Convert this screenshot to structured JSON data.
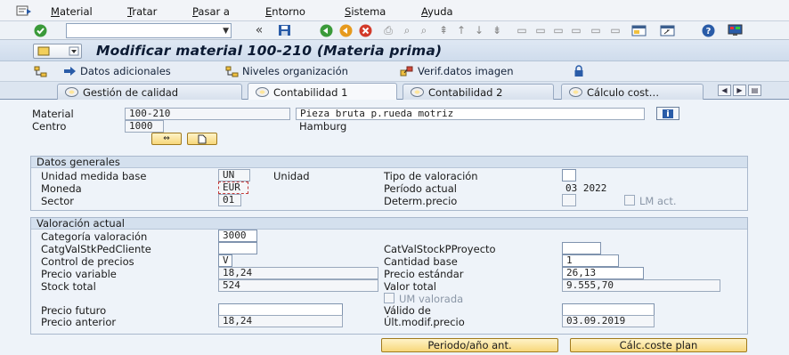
{
  "menu": {
    "items": [
      "Material",
      "Tratar",
      "Pasar a",
      "Entorno",
      "Sistema",
      "Ayuda"
    ],
    "underlined": [
      "M",
      "T",
      "P",
      "E",
      "S",
      "A"
    ]
  },
  "toolbar": {
    "command_value": "",
    "back_glyph": "«"
  },
  "title": {
    "text": "Modificar material 100-210 (Materia prima)"
  },
  "app_toolbar": {
    "items": [
      "Datos adicionales",
      "Niveles organización",
      "Verif.datos imagen"
    ]
  },
  "tabs": {
    "items": [
      "Gestión de calidad",
      "Contabilidad 1",
      "Contabilidad 2",
      "Cálculo cost…"
    ],
    "active": "Contabilidad 1"
  },
  "header": {
    "material_label": "Material",
    "material_value": "100-210",
    "material_desc": "Pieza bruta p.rueda motriz",
    "centro_label": "Centro",
    "centro_value": "1000",
    "centro_desc": "Hamburg"
  },
  "datos_generales": {
    "title": "Datos generales",
    "unidad_label": "Unidad medida base",
    "unidad_value": "UN",
    "unidad_desc": "Unidad",
    "moneda_label": "Moneda",
    "moneda_value": "EUR",
    "sector_label": "Sector",
    "sector_value": "01",
    "tipo_val_label": "Tipo de valoración",
    "periodo_label": "Período actual",
    "periodo_value": "03 2022",
    "determ_label": "Determ.precio",
    "lm_label": "LM act."
  },
  "valoracion": {
    "title": "Valoración actual",
    "categoria_label": "Categoría valoración",
    "categoria_value": "3000",
    "catgval_label": "CatgValStkPedCliente",
    "catval_proy_label": "CatValStockPProyecto",
    "control_label": "Control de precios",
    "control_value": "V",
    "cantidad_base_label": "Cantidad base",
    "cantidad_base_value": "1",
    "precio_variable_label": "Precio variable",
    "precio_variable_value": "18,24",
    "precio_estandar_label": "Precio estándar",
    "precio_estandar_value": "26,13",
    "stock_total_label": "Stock total",
    "stock_total_value": "524",
    "valor_total_label": "Valor total",
    "valor_total_value": "9.555,70",
    "um_valorada_label": "UM valorada",
    "precio_futuro_label": "Precio futuro",
    "valido_de_label": "Válido de",
    "precio_anterior_label": "Precio anterior",
    "precio_anterior_value": "18,24",
    "ult_modif_label": "Últ.modif.precio",
    "ult_modif_value": "03.09.2019"
  },
  "buttons": {
    "periodo_ant": "Periodo/año ant.",
    "calc_coste": "Cálc.coste plan"
  },
  "colors": {
    "background": "#eef3f9",
    "title_bar": "#cfdcec",
    "button_yellow": "#f7d77a"
  }
}
